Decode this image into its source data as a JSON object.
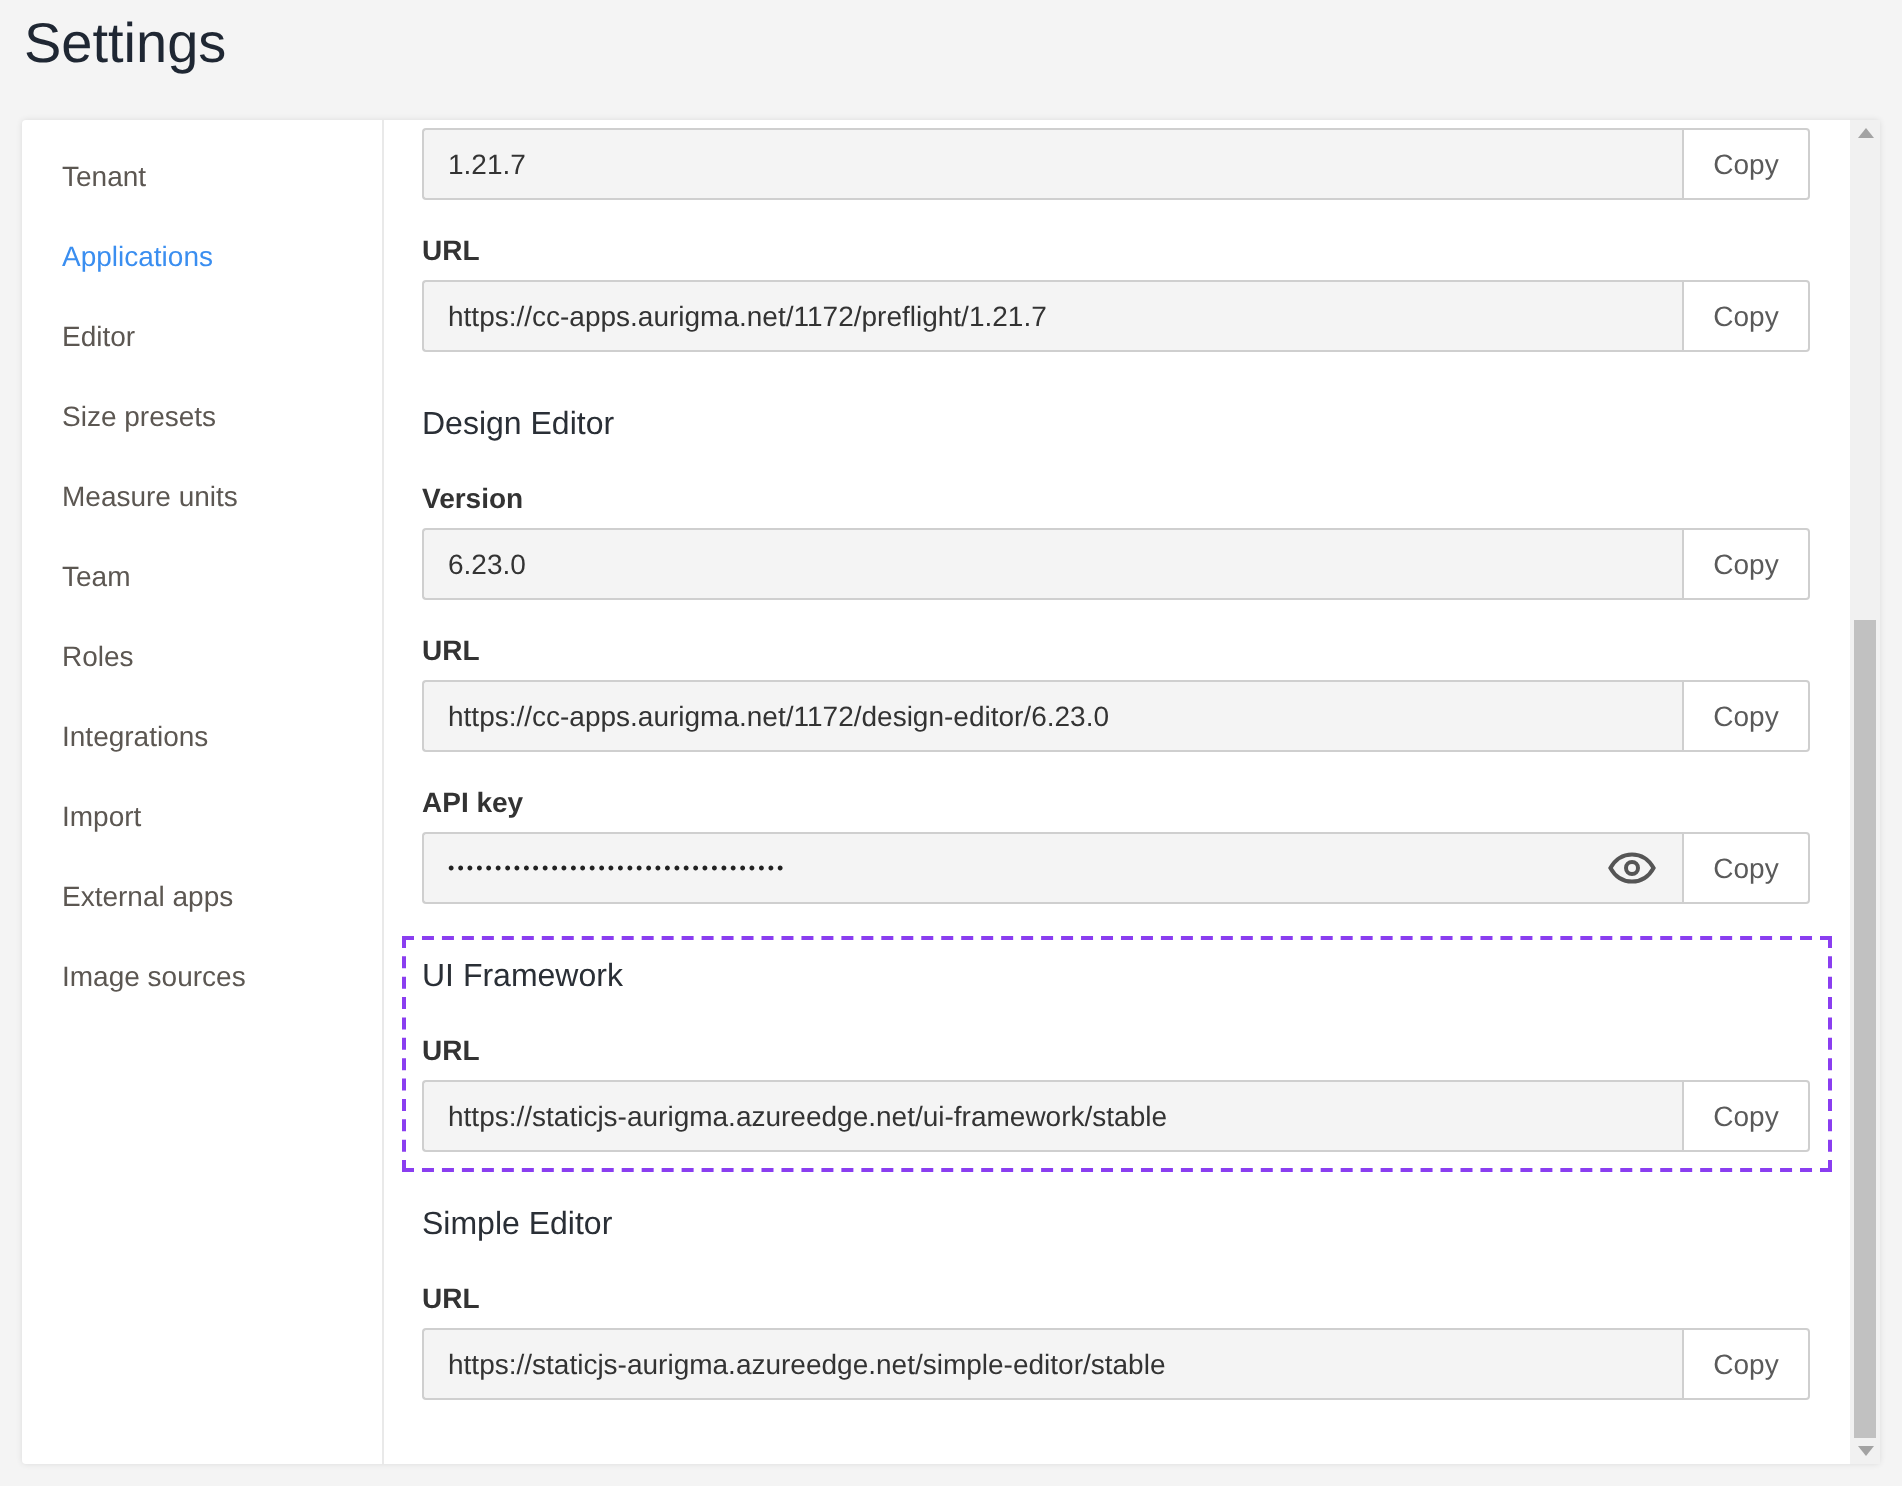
{
  "page": {
    "title": "Settings"
  },
  "sidebar": {
    "items": [
      {
        "label": "Tenant",
        "selected": false
      },
      {
        "label": "Applications",
        "selected": true
      },
      {
        "label": "Editor",
        "selected": false
      },
      {
        "label": "Size presets",
        "selected": false
      },
      {
        "label": "Measure units",
        "selected": false
      },
      {
        "label": "Team",
        "selected": false
      },
      {
        "label": "Roles",
        "selected": false
      },
      {
        "label": "Integrations",
        "selected": false
      },
      {
        "label": "Import",
        "selected": false
      },
      {
        "label": "External apps",
        "selected": false
      },
      {
        "label": "Image sources",
        "selected": false
      }
    ]
  },
  "content": {
    "sections": [
      {
        "highlighted": false,
        "fields": [
          {
            "value": "1.21.7",
            "masked": false,
            "button": "Copy"
          },
          {
            "label": "URL",
            "value": "https://cc-apps.aurigma.net/1172/preflight/1.21.7",
            "masked": false,
            "button": "Copy"
          }
        ]
      },
      {
        "heading": "Design Editor",
        "highlighted": false,
        "fields": [
          {
            "label": "Version",
            "value": "6.23.0",
            "masked": false,
            "button": "Copy"
          },
          {
            "label": "URL",
            "value": "https://cc-apps.aurigma.net/1172/design-editor/6.23.0",
            "masked": false,
            "button": "Copy"
          },
          {
            "label": "API key",
            "value": "••••••••••••••••••••••••••••••••••••",
            "masked": true,
            "button": "Copy"
          }
        ]
      },
      {
        "heading": "UI Framework",
        "highlighted": true,
        "fields": [
          {
            "label": "URL",
            "value": "https://staticjs-aurigma.azureedge.net/ui-framework/stable",
            "masked": false,
            "button": "Copy"
          }
        ]
      },
      {
        "heading": "Simple Editor",
        "highlighted": false,
        "fields": [
          {
            "label": "URL",
            "value": "https://staticjs-aurigma.azureedge.net/simple-editor/stable",
            "masked": false,
            "button": "Copy"
          }
        ]
      }
    ]
  }
}
